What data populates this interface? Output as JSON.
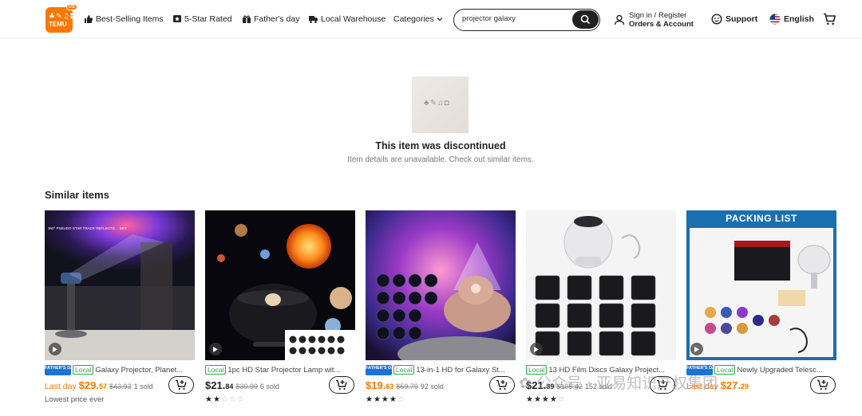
{
  "header": {
    "logo_glyphs": "♣✎♫◘",
    "logo_text": "TEMU",
    "logo_badge": "US",
    "nav": [
      "Best-Selling Items",
      "5-Star Rated",
      "Father's day",
      "Local Warehouse",
      "Categories"
    ],
    "search_value": "projector galaxy",
    "account_line1": "Sign in / Register",
    "account_line2": "Orders & Account",
    "support": "Support",
    "language": "English"
  },
  "notice": {
    "image_glyphs": "♣✎♫◘",
    "title": "This item was discontinued",
    "subtitle": "Item details are unavailable. Check out similar items."
  },
  "similar": {
    "title": "Similar items",
    "products": [
      {
        "fathers_day_badge": "FATHER'S DAY",
        "local_badge": "Local",
        "title": "Galaxy Projector, Planet...",
        "price_label": "Last day",
        "price_main": "$29.",
        "price_cents": "57",
        "old_price": "$43.93",
        "sold": "1 sold",
        "extra": "Lowest price ever"
      },
      {
        "local_badge": "Local",
        "title": "1pc HD Star Projector Lamp wit...",
        "price_main": "$21.",
        "price_cents": "84",
        "old_price": "$39.99",
        "sold": "6 sold",
        "rating": 2
      },
      {
        "fathers_day_badge": "FATHER'S DAY",
        "local_badge": "Local",
        "title": "13-in-1 HD for Galaxy St...",
        "price_main": "$19.",
        "price_cents": "63",
        "old_price": "$59.79",
        "sold": "92 sold",
        "rating": 4.5
      },
      {
        "local_badge": "Local",
        "title": "13 HD Film Discs Galaxy Project...",
        "price_main": "$21.",
        "price_cents": "89",
        "old_price": "$105.42",
        "sold": "152 sold",
        "rating": 4.5
      },
      {
        "fathers_day_badge": "FATHER'S DAY",
        "local_badge": "Local",
        "title": "Newly Upgraded Telesc...",
        "price_label": "Last day",
        "price_main": "$27.",
        "price_cents": "29",
        "packing_list": "PACKING LIST"
      }
    ]
  },
  "watermark": "✿ 公众号 · 亚易知识产权集团"
}
